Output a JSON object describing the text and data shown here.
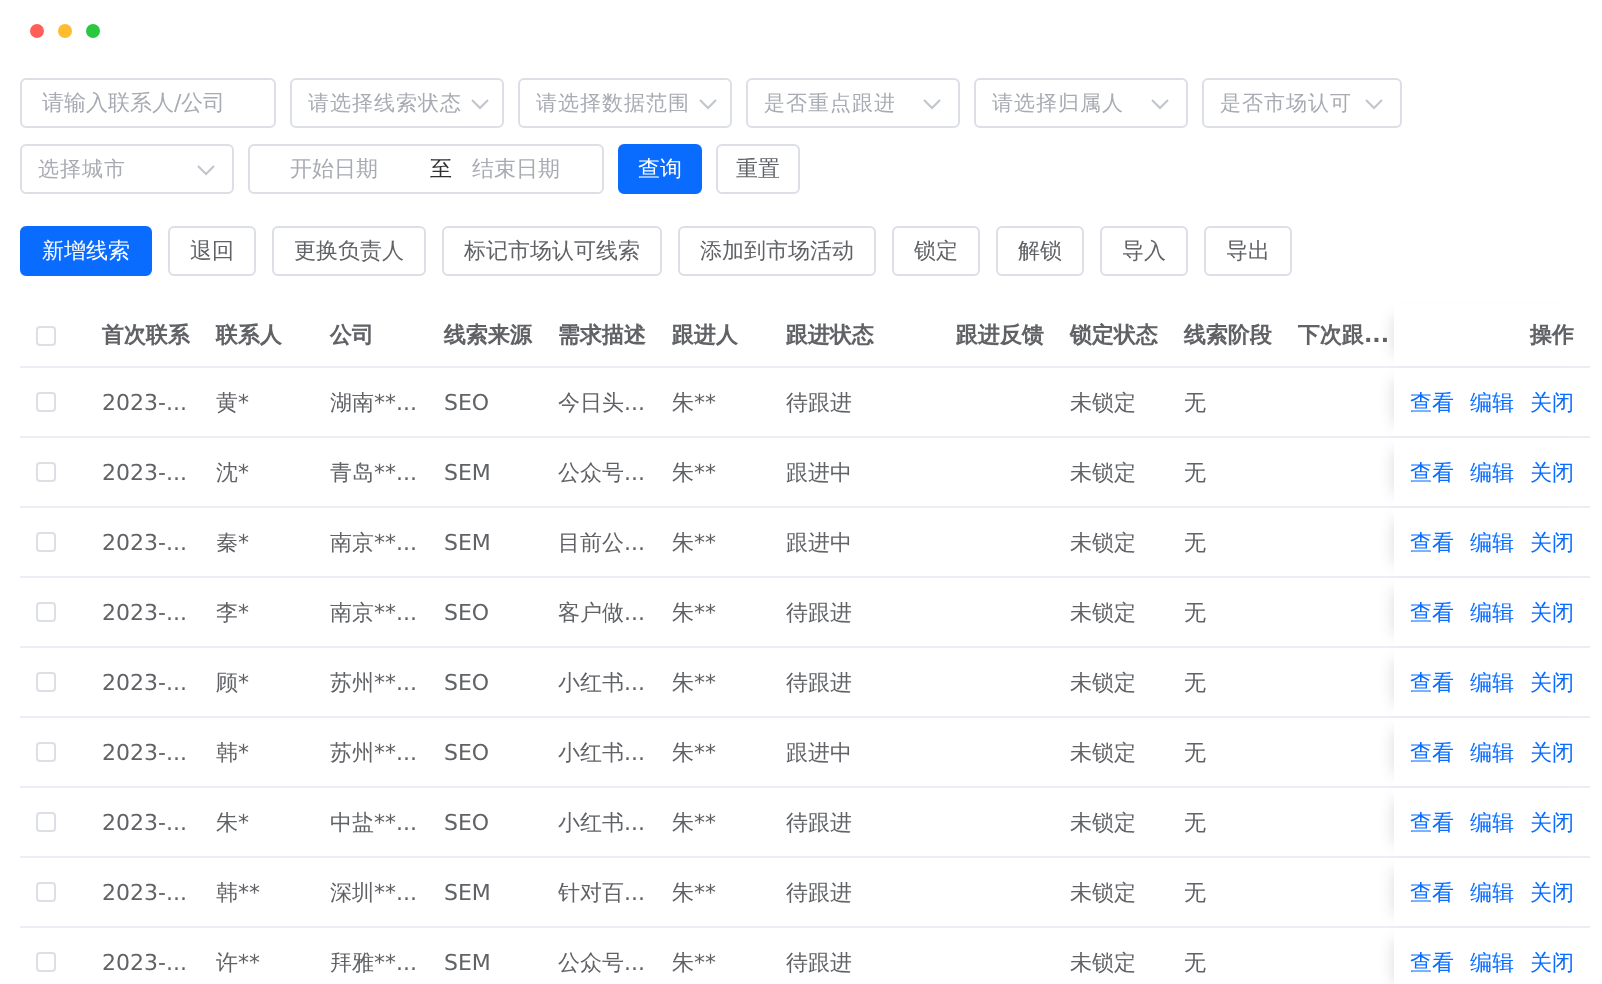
{
  "filters": [
    {
      "kind": "input",
      "placeholder": "请输入联系人/公司"
    },
    {
      "kind": "select",
      "placeholder": "请选择线索状态"
    },
    {
      "kind": "select",
      "placeholder": "请选择数据范围"
    },
    {
      "kind": "select",
      "placeholder": "是否重点跟进"
    },
    {
      "kind": "select",
      "placeholder": "请选择归属人"
    },
    {
      "kind": "select",
      "placeholder": "是否市场认可"
    },
    {
      "kind": "select",
      "placeholder": "选择城市"
    },
    {
      "kind": "daterange",
      "start_placeholder": "开始日期",
      "separator": "至",
      "end_placeholder": "结束日期"
    }
  ],
  "filter_buttons": [
    {
      "label": "查询",
      "kind": "primary"
    },
    {
      "label": "重置",
      "kind": "default"
    }
  ],
  "toolbar": [
    {
      "label": "新增线索",
      "kind": "primary"
    },
    {
      "label": "退回",
      "kind": "default"
    },
    {
      "label": "更换负责人",
      "kind": "default"
    },
    {
      "label": "标记市场认可线索",
      "kind": "default"
    },
    {
      "label": "添加到市场活动",
      "kind": "default"
    },
    {
      "label": "锁定",
      "kind": "default"
    },
    {
      "label": "解锁",
      "kind": "default"
    },
    {
      "label": "导入",
      "kind": "default"
    },
    {
      "label": "导出",
      "kind": "default"
    }
  ],
  "table": {
    "select_all_checked": false,
    "columns": [
      "首次联系",
      "联系人",
      "公司",
      "线索来源",
      "需求描述",
      "跟进人",
      "跟进状态",
      "跟进反馈",
      "锁定状态",
      "线索阶段",
      "下次跟..."
    ],
    "action_column": "操作",
    "rows": [
      {
        "checked": false,
        "cells": [
          "2023-...",
          "黄*",
          "湖南**...",
          "SEO",
          "今日头...",
          "朱**",
          "待跟进",
          "",
          "未锁定",
          "无",
          ""
        ],
        "actions": [
          "查看",
          "编辑",
          "关闭"
        ]
      },
      {
        "checked": false,
        "cells": [
          "2023-...",
          "沈*",
          "青岛**...",
          "SEM",
          "公众号...",
          "朱**",
          "跟进中",
          "",
          "未锁定",
          "无",
          ""
        ],
        "actions": [
          "查看",
          "编辑",
          "关闭"
        ]
      },
      {
        "checked": false,
        "cells": [
          "2023-...",
          "秦*",
          "南京**...",
          "SEM",
          "目前公...",
          "朱**",
          "跟进中",
          "",
          "未锁定",
          "无",
          ""
        ],
        "actions": [
          "查看",
          "编辑",
          "关闭"
        ]
      },
      {
        "checked": false,
        "cells": [
          "2023-...",
          "李*",
          "南京**...",
          "SEO",
          "客户做...",
          "朱**",
          "待跟进",
          "",
          "未锁定",
          "无",
          ""
        ],
        "actions": [
          "查看",
          "编辑",
          "关闭"
        ]
      },
      {
        "checked": false,
        "cells": [
          "2023-...",
          "顾*",
          "苏州**...",
          "SEO",
          "小红书...",
          "朱**",
          "待跟进",
          "",
          "未锁定",
          "无",
          ""
        ],
        "actions": [
          "查看",
          "编辑",
          "关闭"
        ]
      },
      {
        "checked": false,
        "cells": [
          "2023-...",
          "韩*",
          "苏州**...",
          "SEO",
          "小红书...",
          "朱**",
          "跟进中",
          "",
          "未锁定",
          "无",
          ""
        ],
        "actions": [
          "查看",
          "编辑",
          "关闭"
        ]
      },
      {
        "checked": false,
        "cells": [
          "2023-...",
          "朱*",
          "中盐**...",
          "SEO",
          "小红书...",
          "朱**",
          "待跟进",
          "",
          "未锁定",
          "无",
          ""
        ],
        "actions": [
          "查看",
          "编辑",
          "关闭"
        ]
      },
      {
        "checked": false,
        "cells": [
          "2023-...",
          "韩**",
          "深圳**...",
          "SEM",
          "针对百...",
          "朱**",
          "待跟进",
          "",
          "未锁定",
          "无",
          ""
        ],
        "actions": [
          "查看",
          "编辑",
          "关闭"
        ]
      },
      {
        "checked": false,
        "cells": [
          "2023-...",
          "许**",
          "拜雅**...",
          "SEM",
          "公众号...",
          "朱**",
          "待跟进",
          "",
          "未锁定",
          "无",
          ""
        ],
        "actions": [
          "查看",
          "编辑",
          "关闭"
        ]
      }
    ]
  }
}
